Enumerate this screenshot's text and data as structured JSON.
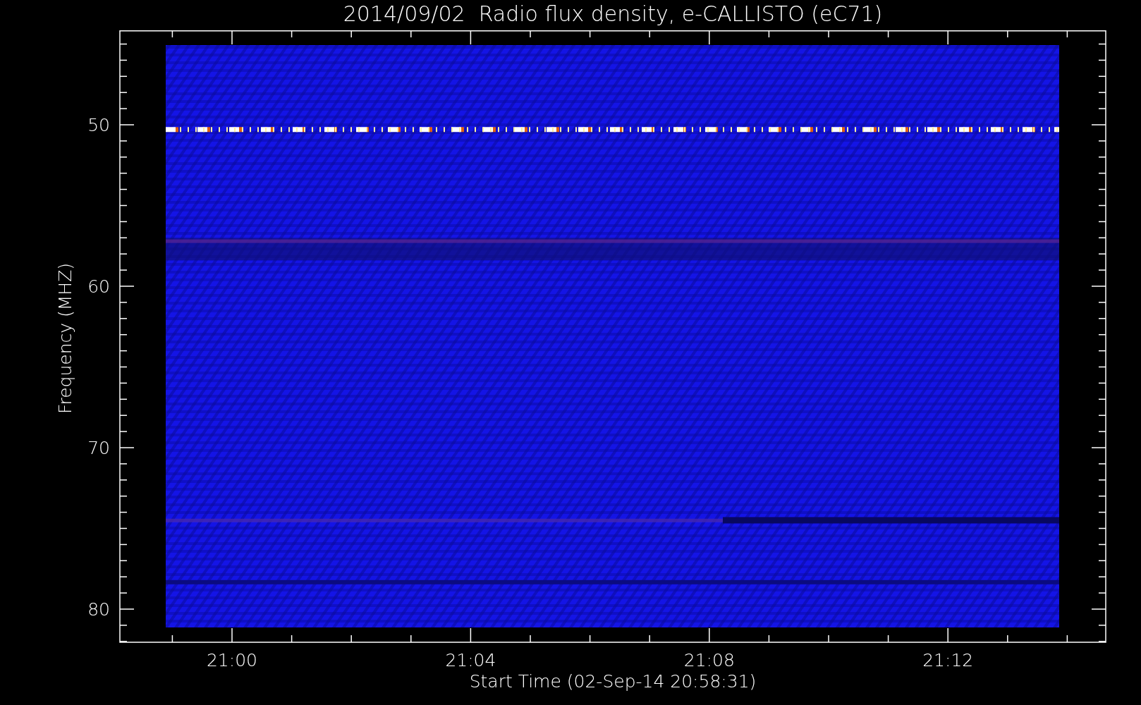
{
  "title": "2014/09/02  Radio flux density, e-CALLISTO (eC71)",
  "plot": {
    "ylabel": "Frequency (MHZ)",
    "xlabel": "Start Time (02-Sep-14 20:58:31)",
    "yticks": [
      "50",
      "60",
      "70",
      "80"
    ],
    "xticks": [
      "21:00",
      "21:04",
      "21:08",
      "21:12"
    ]
  }
}
